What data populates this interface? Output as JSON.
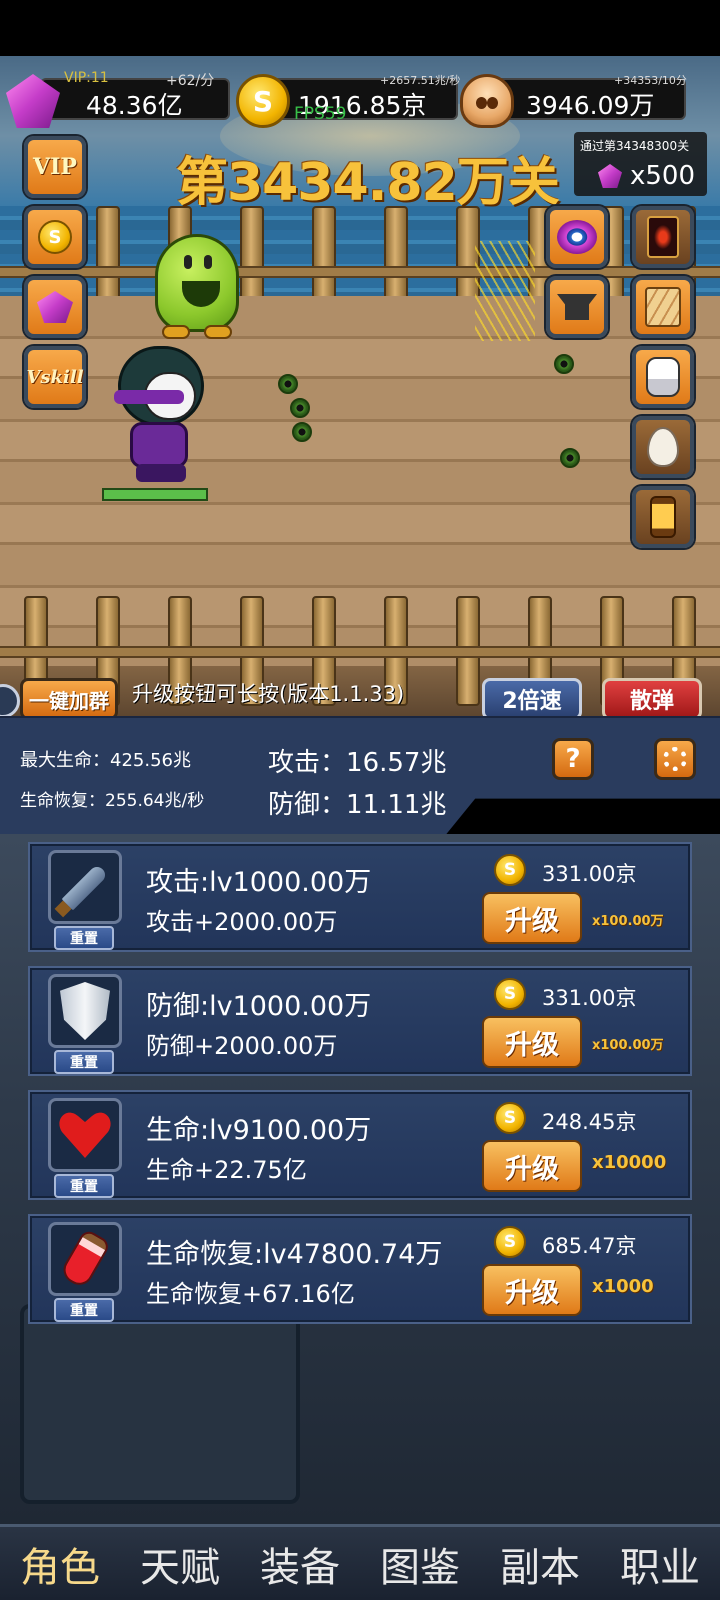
{
  "currencies": {
    "gems": {
      "vip": "VIP:11",
      "rate": "+62/分",
      "value": "48.36亿"
    },
    "gold": {
      "rate": "+2657.51兆/秒",
      "value": "1916.85京",
      "fps": "FPS59"
    },
    "skulls": {
      "rate": "+34353/10分",
      "value": "3946.09万"
    }
  },
  "level": {
    "title": "第3434.82万关",
    "pass_reward_text": "通过第34348300关",
    "pass_reward_count": "x500"
  },
  "side_buttons": {
    "left": [
      "vip",
      "gold",
      "gem",
      "vskill"
    ],
    "vip_label": "VIP",
    "vskill_label": "Vskill"
  },
  "controls": {
    "join_group": "一键加群",
    "tip": "升级按钮可长按(版本1.1.33)",
    "speed": "2倍速",
    "scatter": "散弹"
  },
  "stats": {
    "max_hp_label": "最大生命",
    "max_hp": "425.56兆",
    "regen_label": "生命恢复",
    "regen": "255.64兆/秒",
    "attack_label": "攻击",
    "attack": "16.57兆",
    "defense_label": "防御",
    "defense": "11.11兆",
    "help": "?"
  },
  "upgrades": [
    {
      "title": "攻击:lv1000.00万",
      "bonus": "攻击+2000.00万",
      "cost": "331.00京",
      "button": "升级",
      "multiplier": "x100.00万",
      "reset": "重置",
      "icon": "dagger-icon"
    },
    {
      "title": "防御:lv1000.00万",
      "bonus": "防御+2000.00万",
      "cost": "331.00京",
      "button": "升级",
      "multiplier": "x100.00万",
      "reset": "重置",
      "icon": "shield-icon"
    },
    {
      "title": "生命:lv9100.00万",
      "bonus": "生命+22.75亿",
      "cost": "248.45京",
      "button": "升级",
      "multiplier": "x10000",
      "reset": "重置",
      "icon": "heart-icon"
    },
    {
      "title": "生命恢复:lv47800.74万",
      "bonus": "生命恢复+67.16亿",
      "cost": "685.47京",
      "button": "升级",
      "multiplier": "x1000",
      "reset": "重置",
      "icon": "potion-icon"
    }
  ],
  "coin_symbol": "S",
  "nav": [
    "角色",
    "天赋",
    "装备",
    "图鉴",
    "副本",
    "职业"
  ],
  "colors": {
    "accent_gold": "#f7c23b",
    "panel_blue": "#2a3c5e",
    "button_orange": "#e07a18"
  }
}
